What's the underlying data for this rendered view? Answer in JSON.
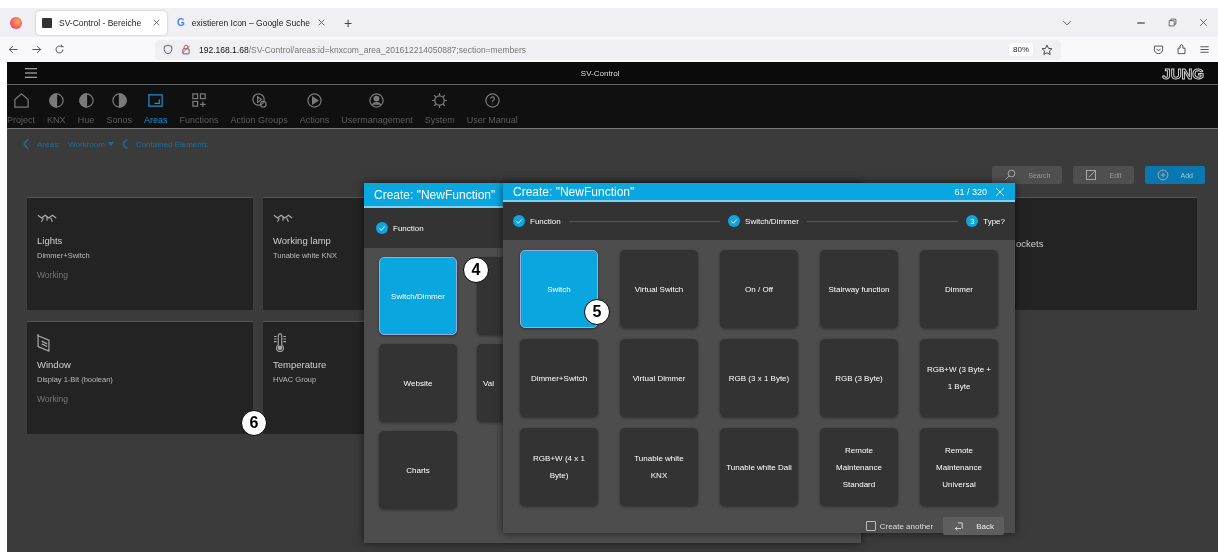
{
  "browser": {
    "tabs": [
      {
        "title": "SV-Control - Bereiche",
        "selected": true
      },
      {
        "title": "existieren Icon – Google Suche",
        "selected": false,
        "icon_text": "G"
      }
    ],
    "new_tab": "+",
    "url_host": "192.168.1.68",
    "url_path": "/SV-Control/areas:id=knxcom_area_201612214050887;section=members",
    "zoom": "80%"
  },
  "app": {
    "title": "SV-Control",
    "logo": "JUNG",
    "nav": [
      {
        "label": "Project",
        "selected": false
      },
      {
        "label": "KNX",
        "selected": false
      },
      {
        "label": "Hue",
        "selected": false
      },
      {
        "label": "Sonos",
        "selected": false
      },
      {
        "label": "Areas",
        "selected": true
      },
      {
        "label": "Functions",
        "selected": false
      },
      {
        "label": "Action Groups",
        "selected": false
      },
      {
        "label": "Actions",
        "selected": false
      },
      {
        "label": "Usermanagement",
        "selected": false
      },
      {
        "label": "System",
        "selected": false
      },
      {
        "label": "User Manual",
        "selected": false
      }
    ],
    "breadcrumb": {
      "area_label": "Areas:",
      "area_value": "Workroom",
      "section": "Contained Elements"
    },
    "toolbar": [
      {
        "kind": "search",
        "label": "Search"
      },
      {
        "kind": "edit",
        "label": "Edit"
      },
      {
        "kind": "add",
        "label": "Add"
      }
    ],
    "cards": [
      {
        "title": "Lights",
        "subtitle": "Dimmer+Switch",
        "status": "Working"
      },
      {
        "title": "Working lamp",
        "subtitle": "Tunable white KNX"
      },
      {
        "title": "ockets"
      },
      {
        "title": "Window",
        "subtitle": "Display 1-Bit (boolean)",
        "status": "Working"
      },
      {
        "title": "Temperature",
        "subtitle": "HVAC Group"
      }
    ]
  },
  "back_dialog": {
    "title": "Create: \"NewFunction\"",
    "steps": [
      {
        "label": "Function",
        "done": true
      }
    ],
    "tiles": [
      {
        "label": "Switch/Dimmer",
        "selected": true
      },
      {
        "selected": false
      },
      {
        "label": "Website",
        "selected": false
      },
      {
        "label": "Val",
        "selected": false
      },
      {
        "label": "Charts",
        "selected": false
      }
    ]
  },
  "front_dialog": {
    "title": "Create: \"NewFunction\"",
    "counter": "61 / 320",
    "steps": [
      {
        "label": "Function",
        "done": true
      },
      {
        "label": "Switch/Dimmer",
        "done": true
      },
      {
        "label": "Type?",
        "done": false,
        "number": "3"
      }
    ],
    "tiles": [
      {
        "label": "Switch",
        "selected": true
      },
      {
        "label": "Virtual Switch",
        "selected": false
      },
      {
        "label": "On / Off",
        "selected": false
      },
      {
        "label": "Stairway function",
        "selected": false
      },
      {
        "label": "Dimmer",
        "selected": false
      },
      {
        "label": "Dimmer+Switch",
        "selected": false
      },
      {
        "label": "Virtual Dimmer",
        "selected": false
      },
      {
        "label": "RGB (3 x 1 Byte)",
        "selected": false
      },
      {
        "label": "RGB (3 Byte)",
        "selected": false
      },
      {
        "label": "RGB+W (3 Byte + 1 Byte",
        "selected": false
      },
      {
        "label": "RGB+W (4 x 1 Byte)",
        "selected": false
      },
      {
        "label": "Tunable white KNX",
        "selected": false
      },
      {
        "label": "Tunable white Dali",
        "selected": false
      },
      {
        "label": "Remote Maintenance Standard",
        "selected": false
      },
      {
        "label": "Remote Maintenance Universal",
        "selected": false
      }
    ],
    "create_another": {
      "label": "Create another",
      "checked": false
    },
    "back_button": "Back"
  },
  "callouts": [
    {
      "number": "4"
    },
    {
      "number": "5"
    },
    {
      "number": "6"
    }
  ]
}
